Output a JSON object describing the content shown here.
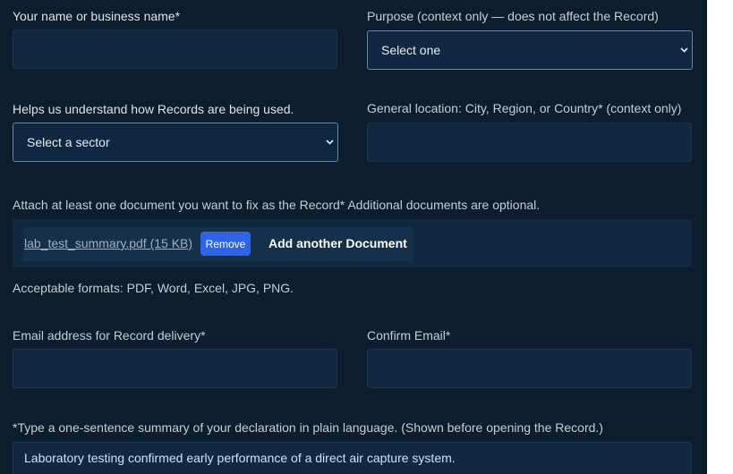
{
  "form": {
    "name_label": "Your name or business name*",
    "purpose_label": "Purpose (context only — does not affect the Record)",
    "purpose_selected": "Select one",
    "sector_label": "Helps us understand how Records are being used.",
    "sector_selected": "Select a sector",
    "location_label": "General location: City, Region, or Country* (context only)",
    "attach_label": "Attach at least one document you want to fix as the Record*  Additional documents are optional.",
    "attached_file": "lab_test_summary.pdf (15 KB)",
    "remove_label": "Remove",
    "add_document_label": "Add another Document",
    "formats_note": "Acceptable formats: PDF, Word, Excel, JPG, PNG.",
    "email_label": "Email address for Record delivery*",
    "confirm_email_label": "Confirm Email*",
    "summary_label": "*Type a one-sentence summary of your declaration in plain language. (Shown before opening the Record.)",
    "summary_value": "Laboratory testing confirmed early performance of a direct air capture system."
  },
  "icons": {
    "dropdown": "chevron-down-icon"
  },
  "colors": {
    "background": "#0c1d2e",
    "field": "#112840",
    "button": "#2f63e8"
  }
}
